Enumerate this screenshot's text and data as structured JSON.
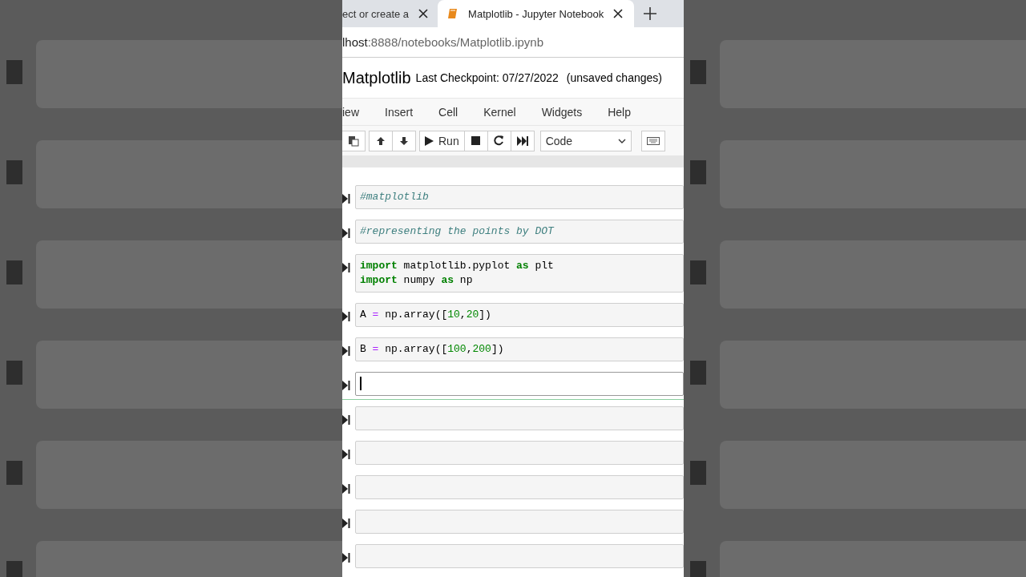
{
  "browser": {
    "tabs": [
      {
        "label": "ect or create a",
        "selected": false
      },
      {
        "label": "Matplotlib - Jupyter Notebook",
        "selected": true
      }
    ],
    "url": {
      "host": "lhost",
      "path": ":8888/notebooks/Matplotlib.ipynb"
    }
  },
  "header": {
    "notebook_name": "Matplotlib",
    "checkpoint": "Last Checkpoint: 07/27/2022",
    "status": "(unsaved changes)"
  },
  "menu": [
    "iew",
    "Insert",
    "Cell",
    "Kernel",
    "Widgets",
    "Help"
  ],
  "toolbar": {
    "run_label": "Run",
    "cell_type": "Code"
  },
  "cells": [
    {
      "selected": false,
      "lines": [
        [
          {
            "kind": "comment",
            "text": "#matplotlib"
          }
        ]
      ]
    },
    {
      "selected": false,
      "lines": [
        [
          {
            "kind": "comment",
            "text": "#representing the points by DOT"
          }
        ]
      ]
    },
    {
      "selected": false,
      "lines": [
        [
          {
            "kind": "keyword",
            "text": "import"
          },
          {
            "kind": "plain",
            "text": " matplotlib.pyplot "
          },
          {
            "kind": "keyword",
            "text": "as"
          },
          {
            "kind": "plain",
            "text": " plt"
          }
        ],
        [
          {
            "kind": "keyword",
            "text": "import"
          },
          {
            "kind": "plain",
            "text": " numpy "
          },
          {
            "kind": "keyword",
            "text": "as"
          },
          {
            "kind": "plain",
            "text": " np"
          }
        ]
      ]
    },
    {
      "selected": false,
      "lines": [
        [
          {
            "kind": "plain",
            "text": "A "
          },
          {
            "kind": "operator",
            "text": "="
          },
          {
            "kind": "plain",
            "text": " np.array(["
          },
          {
            "kind": "number",
            "text": "10"
          },
          {
            "kind": "plain",
            "text": ","
          },
          {
            "kind": "number",
            "text": "20"
          },
          {
            "kind": "plain",
            "text": "])"
          }
        ]
      ]
    },
    {
      "selected": false,
      "lines": [
        [
          {
            "kind": "plain",
            "text": "B "
          },
          {
            "kind": "operator",
            "text": "="
          },
          {
            "kind": "plain",
            "text": " np.array(["
          },
          {
            "kind": "number",
            "text": "100"
          },
          {
            "kind": "plain",
            "text": ","
          },
          {
            "kind": "number",
            "text": "200"
          },
          {
            "kind": "plain",
            "text": "])"
          }
        ]
      ]
    },
    {
      "selected": true
    },
    {
      "selected": false
    },
    {
      "selected": false
    },
    {
      "selected": false
    },
    {
      "selected": false
    },
    {
      "selected": false
    }
  ]
}
